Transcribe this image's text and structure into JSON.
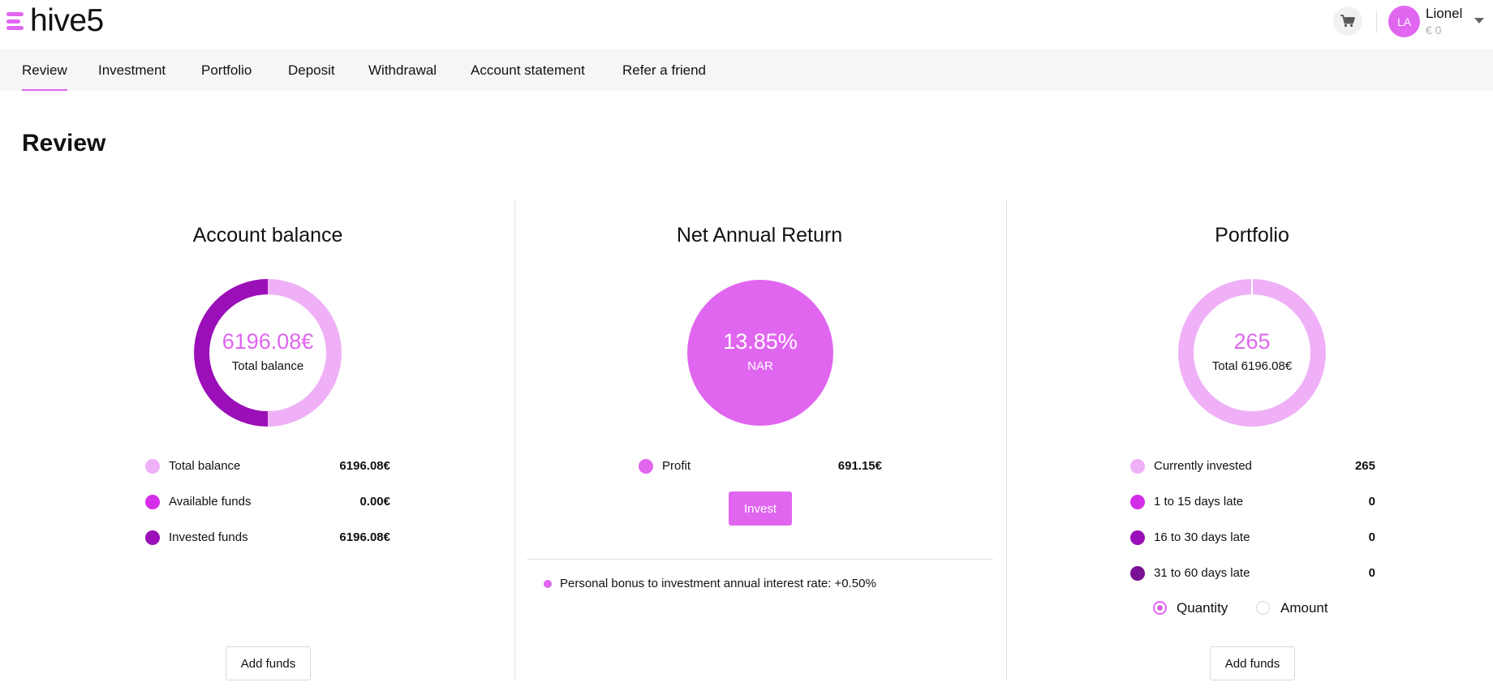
{
  "header": {
    "menu_icon": "hamburger-icon",
    "logo": "hive5",
    "cart_icon": "cart-icon",
    "avatar_initials": "LA",
    "user_name": "Lionel",
    "user_balance": "€ 0"
  },
  "nav": {
    "items": [
      "Review",
      "Investment",
      "Portfolio",
      "Deposit",
      "Withdrawal",
      "Account statement",
      "Refer a friend"
    ],
    "active": "Review"
  },
  "page_title": "Review",
  "colors": {
    "accent": "#e066f0",
    "light": "#efb0f7",
    "medium": "#d42ee8",
    "dark": "#9a0fb8",
    "darkest": "#7a1095"
  },
  "account_balance": {
    "title": "Account balance",
    "center_value": "6196.08€",
    "center_label": "Total balance",
    "legend": [
      {
        "label": "Total balance",
        "value": "6196.08€",
        "color": "#efb0f7"
      },
      {
        "label": "Available funds",
        "value": "0.00€",
        "color": "#d42ee8"
      },
      {
        "label": "Invested funds",
        "value": "6196.08€",
        "color": "#9a0fb8"
      }
    ],
    "button": "Add funds"
  },
  "net_annual_return": {
    "title": "Net Annual Return",
    "center_value": "13.85%",
    "center_label": "NAR",
    "legend": [
      {
        "label": "Profit",
        "value": "691.15€",
        "color": "#e066f0"
      }
    ],
    "button": "Invest",
    "bonus_text": "Personal bonus to investment annual interest rate: +0.50%"
  },
  "portfolio": {
    "title": "Portfolio",
    "center_value": "265",
    "center_label": "Total 6196.08€",
    "legend": [
      {
        "label": "Currently invested",
        "value": "265",
        "color": "#efb0f7"
      },
      {
        "label": "1 to 15 days late",
        "value": "0",
        "color": "#d42ee8"
      },
      {
        "label": "16 to 30 days late",
        "value": "0",
        "color": "#9a0fb8"
      },
      {
        "label": "31 to 60 days late",
        "value": "0",
        "color": "#7a1095"
      }
    ],
    "radios": [
      {
        "label": "Quantity",
        "selected": true
      },
      {
        "label": "Amount",
        "selected": false
      }
    ],
    "button": "Add funds"
  },
  "chart_data": [
    {
      "type": "pie",
      "variant": "donut",
      "title": "Account balance",
      "categories": [
        "Available funds",
        "Invested funds",
        "Total balance"
      ],
      "values": [
        0.0,
        6196.08,
        6196.08
      ]
    },
    {
      "type": "pie",
      "title": "Net Annual Return",
      "categories": [
        "Profit"
      ],
      "values": [
        691.15
      ]
    },
    {
      "type": "pie",
      "variant": "donut",
      "title": "Portfolio",
      "categories": [
        "Currently invested",
        "1 to 15 days late",
        "16 to 30 days late",
        "31 to 60 days late"
      ],
      "values": [
        265,
        0,
        0,
        0
      ]
    }
  ]
}
